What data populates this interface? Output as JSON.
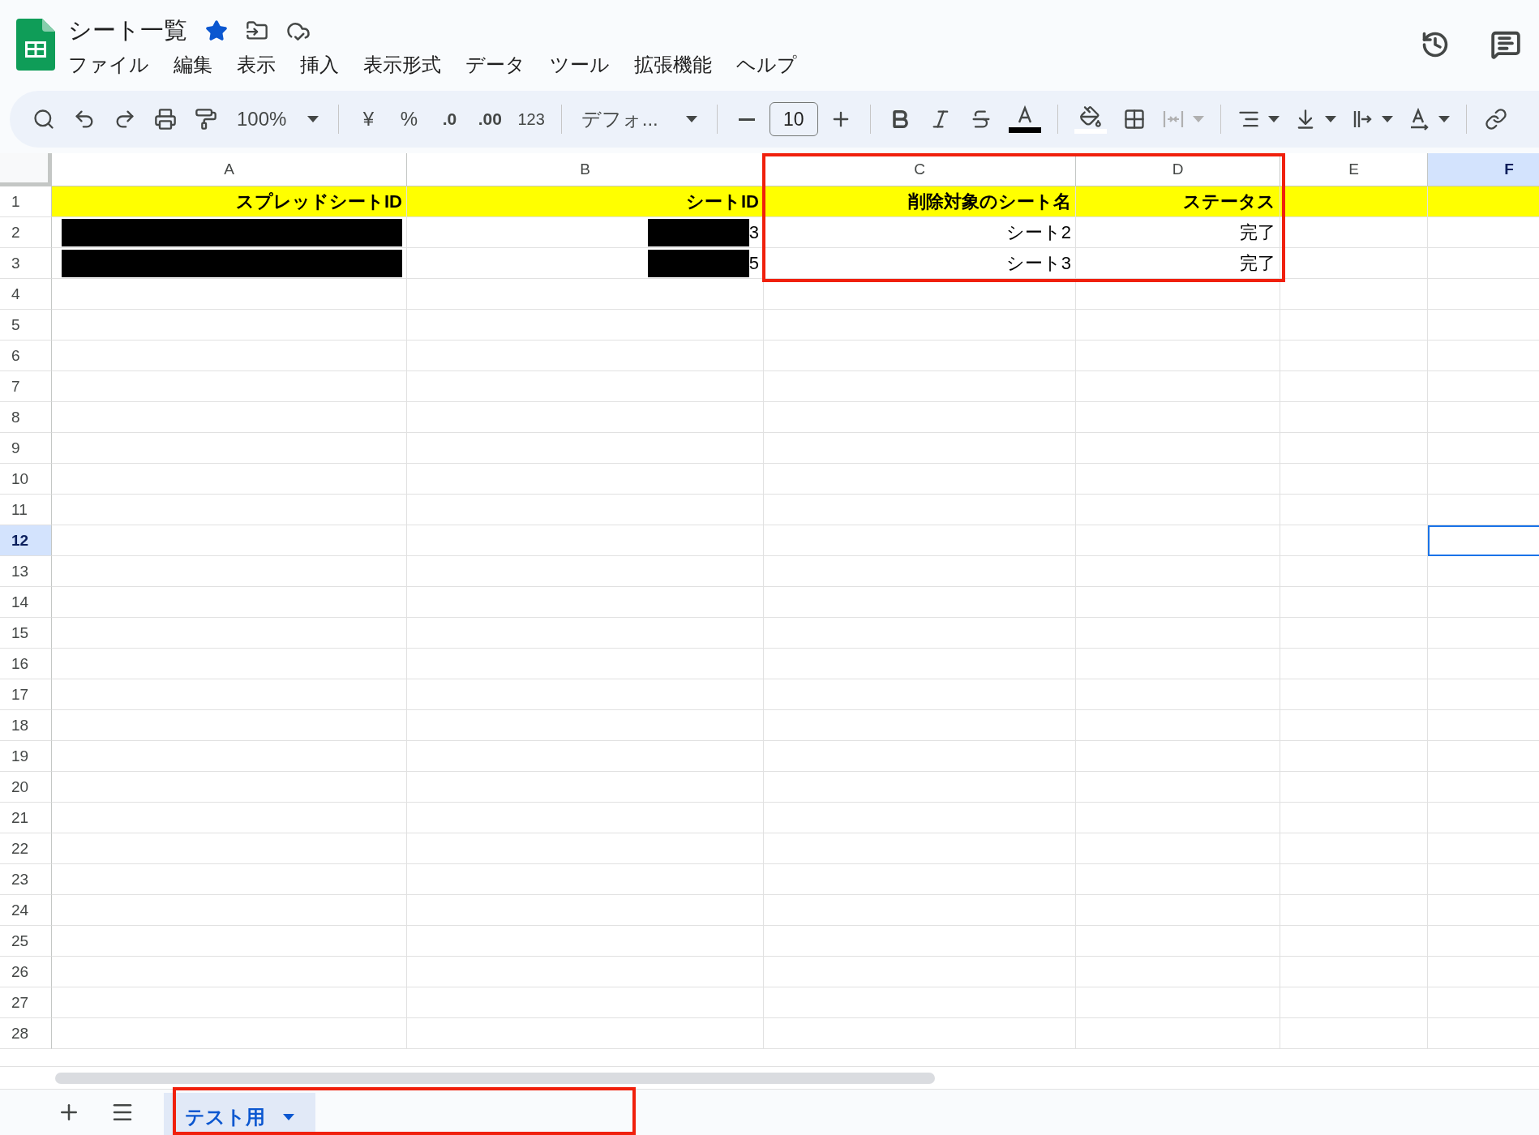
{
  "document": {
    "title": "シート一覧",
    "starred": true
  },
  "menu": [
    "ファイル",
    "編集",
    "表示",
    "挿入",
    "表示形式",
    "データ",
    "ツール",
    "拡張機能",
    "ヘルプ"
  ],
  "toolbar": {
    "zoom": "100%",
    "currency": "¥",
    "percent": "%",
    "decrease_decimal": ".0",
    "increase_decimal": ".00",
    "number_format": "123",
    "font": "デフォ...",
    "font_size": "10"
  },
  "columns": [
    {
      "label": "A",
      "selected": false,
      "highlighted": false
    },
    {
      "label": "B",
      "selected": false,
      "highlighted": false
    },
    {
      "label": "C",
      "selected": false,
      "highlighted": true
    },
    {
      "label": "D",
      "selected": false,
      "highlighted": true
    },
    {
      "label": "E",
      "selected": false,
      "highlighted": false
    },
    {
      "label": "F",
      "selected": true,
      "highlighted": false
    }
  ],
  "rows": [
    {
      "number": "1",
      "selected": false,
      "highlighted": true,
      "cells": [
        {
          "kind": "header",
          "text": "スプレッドシートID"
        },
        {
          "kind": "header",
          "text": "シートID"
        },
        {
          "kind": "header",
          "text": "削除対象のシート名"
        },
        {
          "kind": "header",
          "text": "ステータス"
        },
        {
          "kind": "header"
        },
        {
          "kind": "header"
        }
      ]
    },
    {
      "number": "2",
      "selected": false,
      "highlighted": true,
      "cells": [
        {
          "kind": "redacted"
        },
        {
          "kind": "redacted",
          "text": "3"
        },
        {
          "kind": "value",
          "text": "シート2"
        },
        {
          "kind": "value",
          "text": "完了"
        }
      ]
    },
    {
      "number": "3",
      "selected": false,
      "highlighted": true,
      "cells": [
        {
          "kind": "redacted"
        },
        {
          "kind": "redacted",
          "text": "5"
        },
        {
          "kind": "value",
          "text": "シート3"
        },
        {
          "kind": "value",
          "text": "完了"
        }
      ]
    },
    {
      "number": "4",
      "selected": false,
      "highlighted": false
    },
    {
      "number": "5",
      "selected": false,
      "highlighted": false
    },
    {
      "number": "6",
      "selected": false,
      "highlighted": false
    },
    {
      "number": "7",
      "selected": false,
      "highlighted": false
    },
    {
      "number": "8",
      "selected": false,
      "highlighted": false
    },
    {
      "number": "9",
      "selected": false,
      "highlighted": false
    },
    {
      "number": "10",
      "selected": false,
      "highlighted": false
    },
    {
      "number": "11",
      "selected": false,
      "highlighted": false
    },
    {
      "number": "12",
      "selected": true,
      "highlighted": false
    },
    {
      "number": "13",
      "selected": false,
      "highlighted": false
    },
    {
      "number": "14",
      "selected": false,
      "highlighted": false
    },
    {
      "number": "15",
      "selected": false,
      "highlighted": false
    },
    {
      "number": "16",
      "selected": false,
      "highlighted": false
    },
    {
      "number": "17",
      "selected": false,
      "highlighted": false
    },
    {
      "number": "18",
      "selected": false,
      "highlighted": false
    },
    {
      "number": "19",
      "selected": false,
      "highlighted": false
    },
    {
      "number": "20",
      "selected": false,
      "highlighted": false
    },
    {
      "number": "21",
      "selected": false,
      "highlighted": false
    },
    {
      "number": "22",
      "selected": false,
      "highlighted": false
    },
    {
      "number": "23",
      "selected": false,
      "highlighted": false
    },
    {
      "number": "24",
      "selected": false,
      "highlighted": false
    },
    {
      "number": "25",
      "selected": false,
      "highlighted": false
    },
    {
      "number": "26",
      "selected": false,
      "highlighted": false
    },
    {
      "number": "27",
      "selected": false,
      "highlighted": false
    },
    {
      "number": "28",
      "selected": false,
      "highlighted": false
    }
  ],
  "sheet_bar": {
    "highlighted": true,
    "tabs": [
      {
        "label": "テスト用",
        "selected": true
      }
    ]
  }
}
